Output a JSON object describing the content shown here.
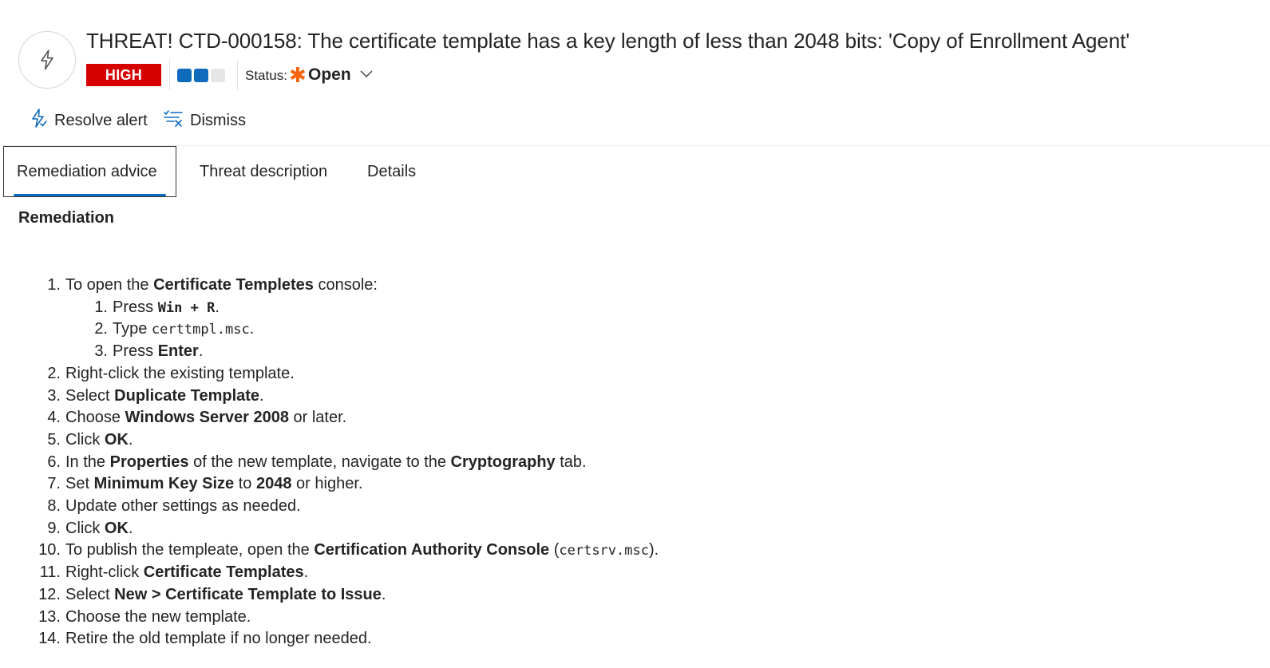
{
  "header": {
    "title": "THREAT! CTD-000158: The certificate template has a key length of less than 2048 bits: 'Copy of Enrollment Agent'",
    "severity": "HIGH",
    "severity_color": "#d70000",
    "status_label": "Status:",
    "status_value": "Open",
    "status_icon": "asterisk-icon",
    "status_icon_color": "#f7630c",
    "confidence_segments": [
      {
        "filled": true,
        "color": "#0f6cbd"
      },
      {
        "filled": true,
        "color": "#0f6cbd"
      },
      {
        "filled": false,
        "color": "#e6e6e6"
      }
    ]
  },
  "toolbar": {
    "resolve_label": "Resolve alert",
    "resolve_icon": "lightning-icon",
    "dismiss_label": "Dismiss",
    "dismiss_icon": "dismiss-list-icon",
    "accent_color": "#0f6cbd"
  },
  "tabs": [
    {
      "label": "Remediation advice",
      "active": true
    },
    {
      "label": "Threat description",
      "active": false
    },
    {
      "label": "Details",
      "active": false
    }
  ],
  "section": {
    "title": "Remediation"
  },
  "steps": [
    {
      "n": "1.",
      "parts": [
        [
          "t",
          "To open the "
        ],
        [
          "b",
          "Certificate Templetes"
        ],
        [
          "t",
          " console:"
        ]
      ],
      "sub": [
        {
          "n": "1.",
          "parts": [
            [
              "t",
              "Press "
            ],
            [
              "cb",
              "Win + R"
            ],
            [
              "t",
              "."
            ]
          ]
        },
        {
          "n": "2.",
          "parts": [
            [
              "t",
              "Type "
            ],
            [
              "c",
              "certtmpl.msc"
            ],
            [
              "t",
              "."
            ]
          ]
        },
        {
          "n": "3.",
          "parts": [
            [
              "t",
              "Press "
            ],
            [
              "b",
              "Enter"
            ],
            [
              "t",
              "."
            ]
          ]
        }
      ]
    },
    {
      "n": "2.",
      "parts": [
        [
          "t",
          "Right-click the existing template."
        ]
      ]
    },
    {
      "n": "3.",
      "parts": [
        [
          "t",
          "Select "
        ],
        [
          "b",
          "Duplicate Template"
        ],
        [
          "t",
          "."
        ]
      ]
    },
    {
      "n": "4.",
      "parts": [
        [
          "t",
          "Choose "
        ],
        [
          "b",
          "Windows Server 2008"
        ],
        [
          "t",
          " or later."
        ]
      ]
    },
    {
      "n": "5.",
      "parts": [
        [
          "t",
          "Click "
        ],
        [
          "b",
          "OK"
        ],
        [
          "t",
          "."
        ]
      ]
    },
    {
      "n": "6.",
      "parts": [
        [
          "t",
          "In the "
        ],
        [
          "b",
          "Properties"
        ],
        [
          "t",
          " of the new template, navigate to the "
        ],
        [
          "b",
          "Cryptography"
        ],
        [
          "t",
          " tab."
        ]
      ]
    },
    {
      "n": "7.",
      "parts": [
        [
          "t",
          "Set "
        ],
        [
          "b",
          "Minimum Key Size"
        ],
        [
          "t",
          " to "
        ],
        [
          "b",
          "2048"
        ],
        [
          "t",
          " or higher."
        ]
      ]
    },
    {
      "n": "8.",
      "parts": [
        [
          "t",
          "Update other settings as needed."
        ]
      ]
    },
    {
      "n": "9.",
      "parts": [
        [
          "t",
          "Click "
        ],
        [
          "b",
          "OK"
        ],
        [
          "t",
          "."
        ]
      ]
    },
    {
      "n": "10.",
      "parts": [
        [
          "t",
          "To publish the templeate, open the "
        ],
        [
          "b",
          "Certification Authority Console"
        ],
        [
          "t",
          " ("
        ],
        [
          "c",
          "certsrv.msc"
        ],
        [
          "t",
          ")."
        ]
      ]
    },
    {
      "n": "11.",
      "parts": [
        [
          "t",
          "Right-click "
        ],
        [
          "b",
          "Certificate Templates"
        ],
        [
          "t",
          "."
        ]
      ]
    },
    {
      "n": "12.",
      "parts": [
        [
          "t",
          "Select "
        ],
        [
          "b",
          "New > Certificate Template to Issue"
        ],
        [
          "t",
          "."
        ]
      ]
    },
    {
      "n": "13.",
      "parts": [
        [
          "t",
          "Choose the new template."
        ]
      ]
    },
    {
      "n": "14.",
      "parts": [
        [
          "t",
          "Retire the old template if no longer needed."
        ]
      ]
    }
  ]
}
